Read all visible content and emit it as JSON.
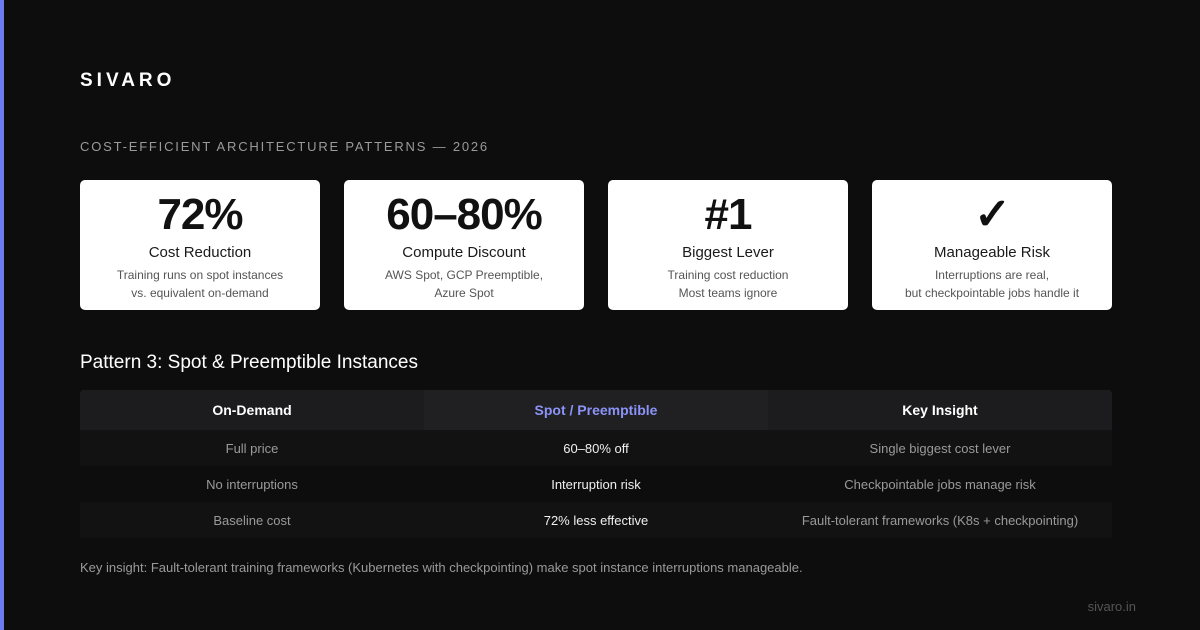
{
  "brand": "SIVARO",
  "subtitle": "COST-EFFICIENT ARCHITECTURE PATTERNS — 2026",
  "colors": {
    "accent": "#6c7bf0",
    "spot_header": "#8b93f8",
    "background": "#0d0d0d",
    "card": "#ffffff"
  },
  "cards": [
    {
      "value": "72%",
      "label": "Cost Reduction",
      "desc": [
        "Training runs on spot instances",
        "vs. equivalent on-demand"
      ]
    },
    {
      "value": "60–80%",
      "label": "Compute Discount",
      "desc": [
        "AWS Spot, GCP Preemptible,",
        "Azure Spot"
      ]
    },
    {
      "value": "#1",
      "label": "Biggest Lever",
      "desc": [
        "Training cost reduction",
        "Most teams ignore"
      ]
    },
    {
      "value": "✓",
      "label": "Manageable Risk",
      "desc": [
        "Interruptions are real,",
        "but checkpointable jobs handle it"
      ]
    }
  ],
  "section_title": "Pattern 3: Spot & Preemptible Instances",
  "table": {
    "headers": [
      "On-Demand",
      "Spot / Preemptible",
      "Key Insight"
    ],
    "rows": [
      [
        "Full price",
        "60–80% off",
        "Single biggest cost lever"
      ],
      [
        "No interruptions",
        "Interruption risk",
        "Checkpointable jobs manage risk"
      ],
      [
        "Baseline cost",
        "72% less effective",
        "Fault-tolerant frameworks (K8s + checkpointing)"
      ]
    ]
  },
  "footnote": "Key insight: Fault-tolerant training frameworks (Kubernetes with checkpointing) make spot instance interruptions manageable.",
  "site": "sivaro.in"
}
